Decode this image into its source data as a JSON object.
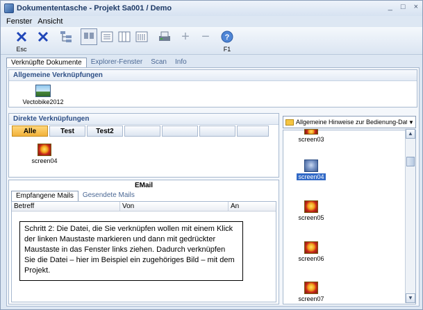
{
  "window": {
    "title": "Dokumententasche - Projekt Sa001 / Demo",
    "controls": [
      "_",
      "□",
      "×"
    ]
  },
  "menu": [
    "Fenster",
    "Ansicht"
  ],
  "toolbar": {
    "esc_label": "Esc",
    "f1_label": "F1",
    "plus": "+",
    "minus": "−"
  },
  "tabs": [
    "Verknüpfte Dokumente",
    "Explorer-Fenster",
    "Scan",
    "Info"
  ],
  "general": {
    "title": "Allgemeine Verknüpfungen",
    "files": [
      {
        "name": "Vectobike2012"
      }
    ]
  },
  "direct": {
    "title": "Direkte Verknüpfungen",
    "filters": [
      "Alle",
      "Test",
      "Test2"
    ],
    "files": [
      {
        "name": "screen04"
      }
    ]
  },
  "email": {
    "title": "EMail",
    "tabs": [
      "Empfangene Mails",
      "Gesendete Mails"
    ],
    "columns": [
      "Betreff",
      "Von",
      "An"
    ]
  },
  "note": "Schritt 2: Die Datei, die Sie verknüpfen wollen mit einem Klick der linken Maustaste markieren und dann mit gedrückter Maustaste in das Fenster links ziehen. Dadurch verknüpfen Sie die Datei – hier im Beispiel ein zugehöriges Bild – mit dem Projekt.",
  "explorer": {
    "folder": "Allgemeine Hinweise zur Bedienung-Dateien",
    "files": [
      "screen03",
      "screen04",
      "screen05",
      "screen06",
      "screen07"
    ],
    "selected": "screen04"
  }
}
